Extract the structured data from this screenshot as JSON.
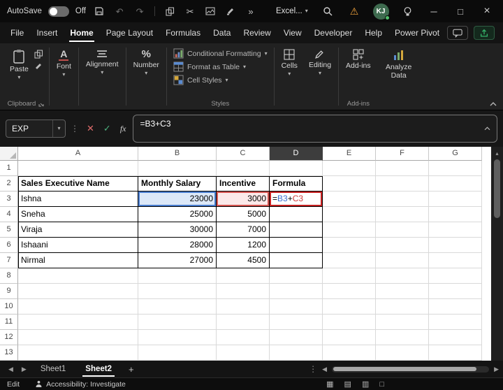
{
  "titlebar": {
    "autosave_label": "AutoSave",
    "autosave_state": "Off",
    "overflow": "»",
    "app_label": "Excel...",
    "avatar_initials": "KJ",
    "minimize": "─",
    "maximize": "□",
    "close": "×",
    "undo": "↶",
    "redo": "↷",
    "cut": "✂"
  },
  "menu": {
    "items": [
      "File",
      "Insert",
      "Home",
      "Page Layout",
      "Formulas",
      "Data",
      "Review",
      "View",
      "Developer",
      "Help",
      "Power Pivot"
    ],
    "active": "Home"
  },
  "ribbon": {
    "paste_label": "Paste",
    "font_label": "Font",
    "alignment_label": "Alignment",
    "number_label": "Number",
    "styles": [
      "Conditional Formatting",
      "Format as Table",
      "Cell Styles"
    ],
    "cells_label": "Cells",
    "editing_label": "Editing",
    "addins_label": "Add-ins",
    "analyze_label": "Analyze Data",
    "clipboard_group_label": "Clipboard",
    "styles_group_label": "Styles",
    "addins_group_label": "Add-ins"
  },
  "formula_bar": {
    "name_box": "EXP",
    "formula": "=B3+C3",
    "tokens": {
      "eq": "=",
      "ref1": "B3",
      "op": "+",
      "ref2": "C3"
    }
  },
  "grid": {
    "columns": [
      "A",
      "B",
      "C",
      "D",
      "E",
      "F",
      "G"
    ],
    "selected_column": "D",
    "rows": [
      "1",
      "2",
      "3",
      "4",
      "5",
      "6",
      "7",
      "8",
      "9",
      "10",
      "11",
      "12",
      "13"
    ],
    "header_row": [
      "Sales Executive Name",
      "Monthly Salary",
      "Incentive",
      "Formula"
    ],
    "records": [
      {
        "name": "Ishna",
        "salary": "23000",
        "incentive": "3000"
      },
      {
        "name": "Sneha",
        "salary": "25000",
        "incentive": "5000"
      },
      {
        "name": "Viraja",
        "salary": "30000",
        "incentive": "7000"
      },
      {
        "name": "Ishaani",
        "salary": "28000",
        "incentive": "1200"
      },
      {
        "name": "Nirmal",
        "salary": "27000",
        "incentive": "4500"
      }
    ]
  },
  "sheet_tabs": {
    "tabs": [
      "Sheet1",
      "Sheet2"
    ],
    "active": "Sheet2",
    "add": "+"
  },
  "status": {
    "mode": "Edit",
    "accessibility": "Accessibility: Investigate"
  }
}
